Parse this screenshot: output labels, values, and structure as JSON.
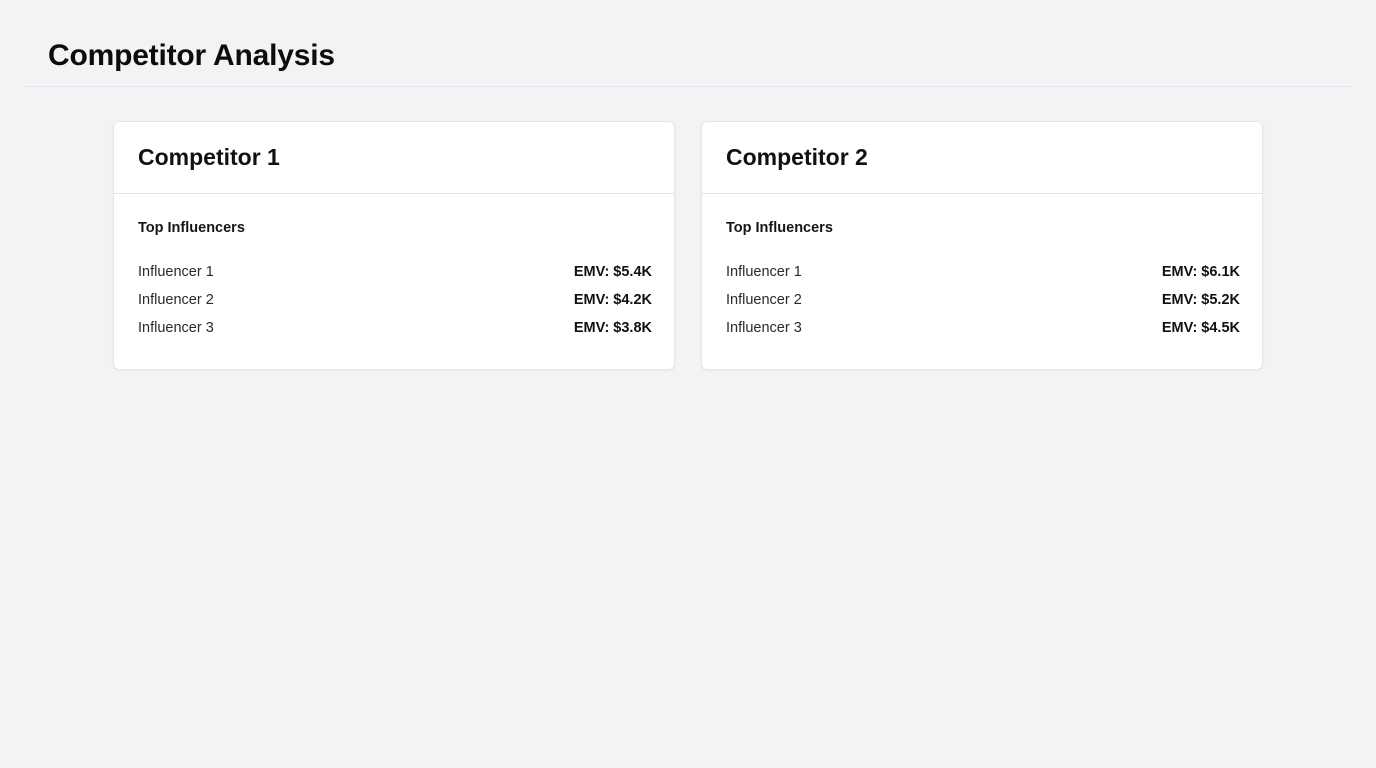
{
  "header": {
    "title": "Competitor Analysis"
  },
  "competitors": [
    {
      "name": "Competitor 1",
      "section_label": "Top Influencers",
      "influencers": [
        {
          "name": "Influencer 1",
          "emv": "EMV: $5.4K"
        },
        {
          "name": "Influencer 2",
          "emv": "EMV: $4.2K"
        },
        {
          "name": "Influencer 3",
          "emv": "EMV: $3.8K"
        }
      ]
    },
    {
      "name": "Competitor 2",
      "section_label": "Top Influencers",
      "influencers": [
        {
          "name": "Influencer 1",
          "emv": "EMV: $6.1K"
        },
        {
          "name": "Influencer 2",
          "emv": "EMV: $5.2K"
        },
        {
          "name": "Influencer 3",
          "emv": "EMV: $4.5K"
        }
      ]
    }
  ]
}
